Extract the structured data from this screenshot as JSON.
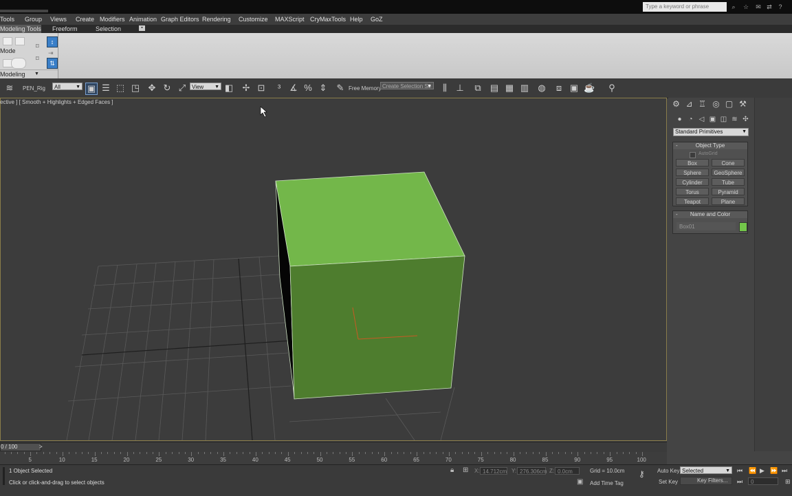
{
  "titlebar": {
    "search_placeholder": "Type a keyword or phrase"
  },
  "menu": [
    "Tools",
    "Group",
    "Views",
    "Create",
    "Modifiers",
    "Animation",
    "Graph Editors",
    "Rendering",
    "Customize",
    "MAXScript",
    "CryMaxTools",
    "Help",
    "GoZ"
  ],
  "ribbon": {
    "tabs": [
      "Modeling Tools",
      "Freeform",
      "Selection"
    ],
    "mode_label": "Mode",
    "footer_label": "Modeling"
  },
  "toolbar": {
    "set_label": "PEN_Rig",
    "filter_value": "All",
    "ref_coord_value": "View",
    "free_memory_label": "Free Memory",
    "selection_set_placeholder": "Create Selection Se"
  },
  "viewport": {
    "label": "ective ] [ Smooth + Highlights + Edged Faces ]",
    "box_color": "#73b74a",
    "box_front_color": "#4e7d2e"
  },
  "command_panel": {
    "dropdown_value": "Standard Primitives",
    "object_type_header": "Object Type",
    "autogrid_label": "AutoGrid",
    "buttons": [
      "Box",
      "Cone",
      "Sphere",
      "GeoSphere",
      "Cylinder",
      "Tube",
      "Torus",
      "Pyramid",
      "Teapot",
      "Plane"
    ],
    "name_color_header": "Name and Color",
    "object_name": "Box01",
    "object_color": "#73c64a"
  },
  "timeline": {
    "frame_counter": "0 / 100",
    "next_label": ">",
    "ticks": [
      "5",
      "10",
      "15",
      "20",
      "25",
      "30",
      "35",
      "40",
      "45",
      "50",
      "55",
      "60",
      "65",
      "70",
      "75",
      "80",
      "85",
      "90",
      "95",
      "100"
    ]
  },
  "status": {
    "selected_text": "1 Object Selected",
    "prompt_text": "Click or click-and-drag to select objects",
    "x_label": "X:",
    "x_value": "14.712cm",
    "y_label": "Y:",
    "y_value": "276.306cm",
    "z_label": "Z:",
    "z_value": "0.0cm",
    "grid_text": "Grid = 10.0cm",
    "add_time_tag": "Add Time Tag",
    "auto_key": "Auto Key",
    "set_key": "Set Key",
    "selected_dropdown": "Selected",
    "key_filters": "Key Filters...",
    "frame_value": "0"
  }
}
